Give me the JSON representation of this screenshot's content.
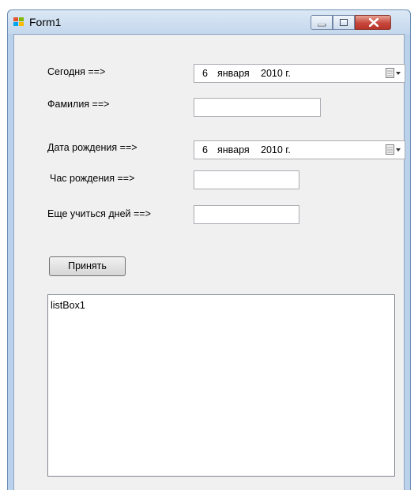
{
  "window": {
    "title": "Form1"
  },
  "form": {
    "today_label": "Сегодня ==>",
    "today_date": {
      "day": "6",
      "month": "января",
      "year": "2010 г."
    },
    "surname_label": "Фамилия ==>",
    "surname_value": "",
    "birthdate_label": "Дата рождения ==>",
    "birth_date": {
      "day": "6",
      "month": "января",
      "year": "2010 г."
    },
    "birth_hour_label": "Час рождения ==>",
    "birth_hour_value": "",
    "days_left_label": "Еще учиться дней ==>",
    "days_left_value": "",
    "accept_button": "Принять"
  },
  "listbox": {
    "items": [
      "listBox1"
    ]
  },
  "icons": {
    "app": "windows-form-icon",
    "minimize": "minimize-icon",
    "maximize": "maximize-icon",
    "close": "close-icon",
    "calendar_dropdown": "calendar-dropdown-icon"
  },
  "colors": {
    "frame": "#b9d1ea",
    "client": "#f0f0f0",
    "close_button": "#c7463b"
  }
}
